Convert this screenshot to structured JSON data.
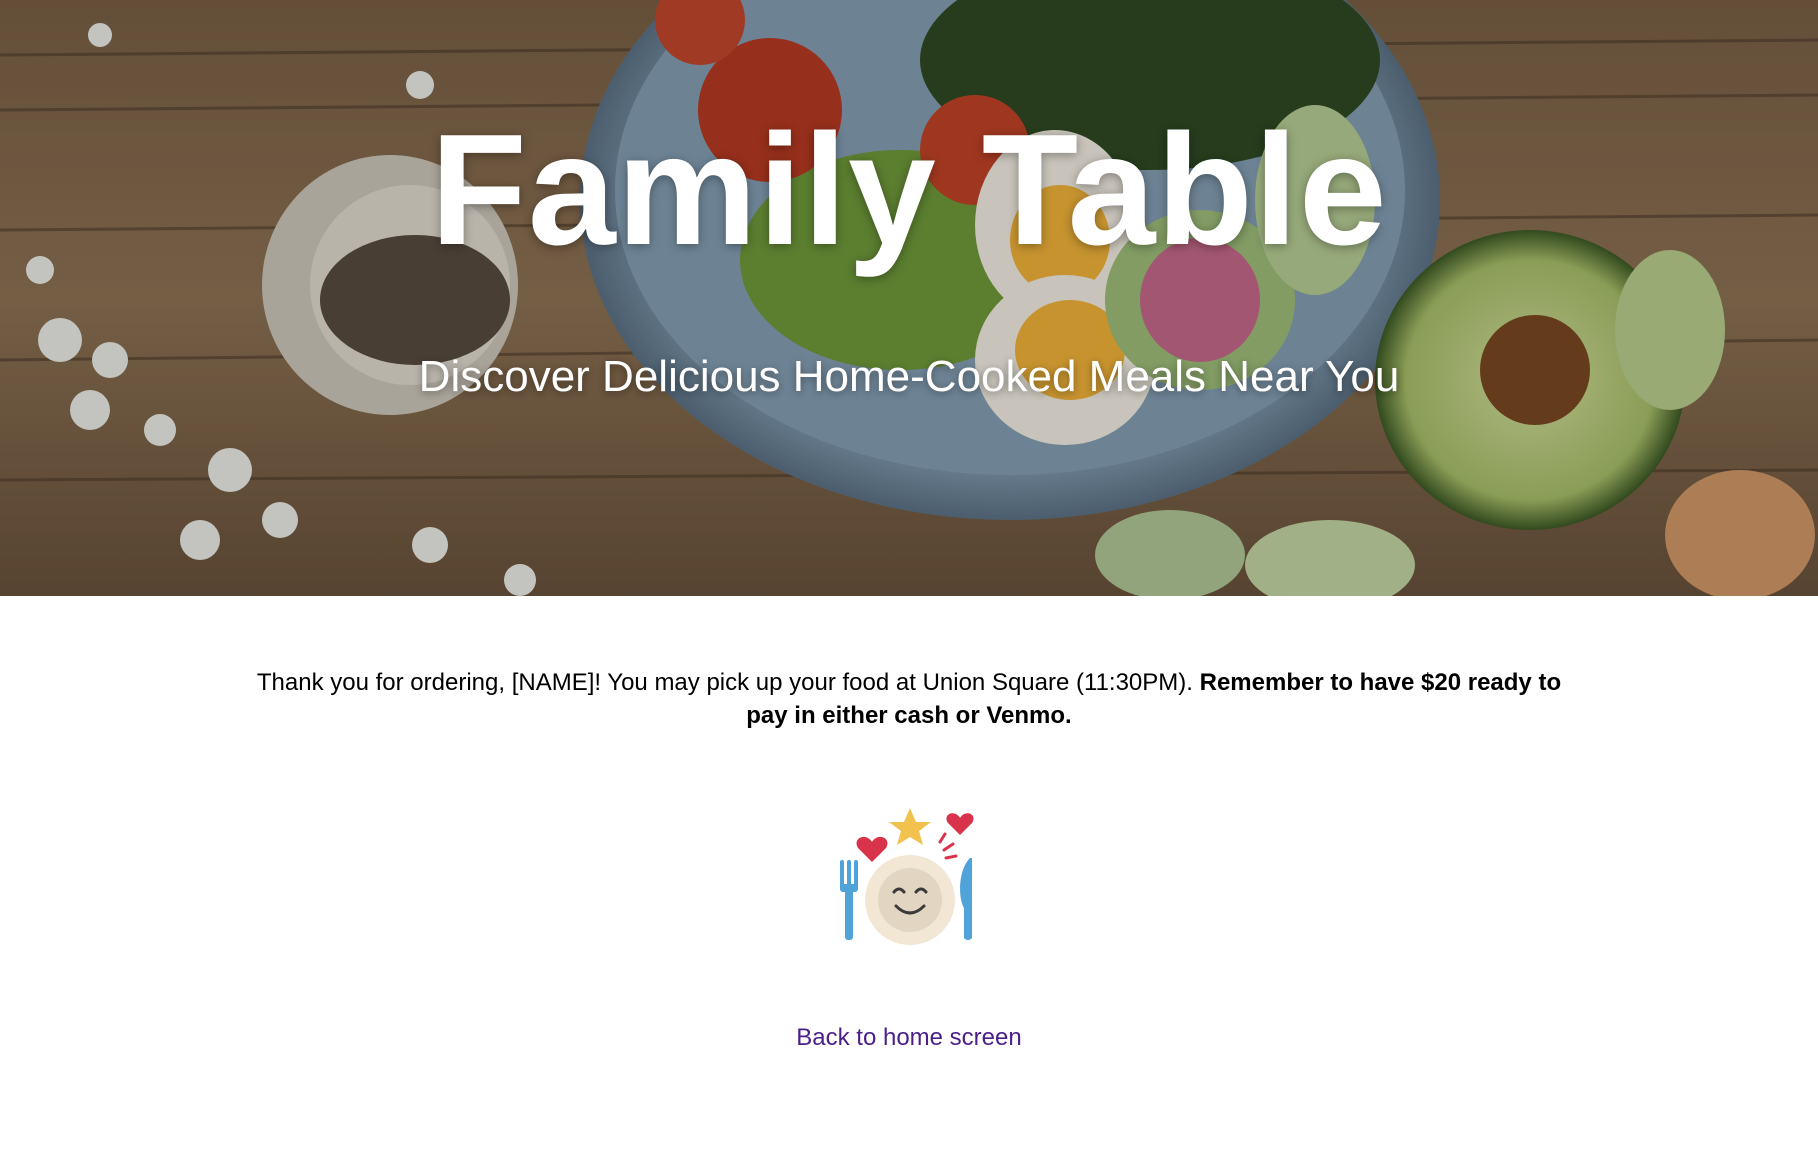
{
  "hero": {
    "title": "Family Table",
    "subtitle": "Discover Delicious Home-Cooked Meals Near You",
    "image": "food-bowl-on-wooden-table"
  },
  "confirmation": {
    "message_regular": "Thank you for ordering, [NAME]! You may pick up your food at Union Square (11:30PM). ",
    "message_bold": "Remember to have $20 ready to pay in either cash or Venmo."
  },
  "illustration": {
    "icon": "happy-plate-fork-knife-icon"
  },
  "back_link": {
    "label": "Back to home screen"
  },
  "colors": {
    "link": "#4b1f8a",
    "heart": "#d8334a",
    "star": "#f2c14e",
    "utensils": "#4fa3d8",
    "plate": "#f2e6d4",
    "face": "#e2d5c2"
  }
}
